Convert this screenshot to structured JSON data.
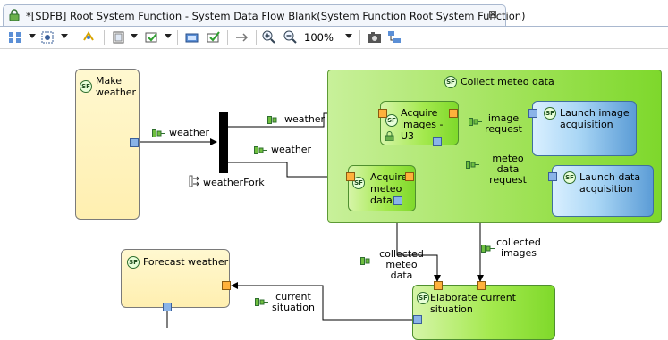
{
  "tab": {
    "title": "*[SDFB] Root System Function - System Data Flow Blank(System Function Root System Function)",
    "close_glyph": "⊠"
  },
  "toolbar": {
    "zoom_level": "100%",
    "icons": [
      "select-icon",
      "dropdown",
      "arrange-icon",
      "dropdown",
      "refresh-icon",
      "layer-icon",
      "dropdown",
      "filter-icon",
      "dropdown",
      "export-icon",
      "apply-icon",
      "hide-icon",
      "zoom-in-icon",
      "zoom-out-icon",
      "zoom-level",
      "dropdown",
      "camera-icon",
      "diagram-props-icon"
    ]
  },
  "diagram": {
    "functions": {
      "make_weather": "Make weather",
      "forecast_weather": "Forecast weather",
      "collect_meteo_data": "Collect meteo data",
      "acquire_images": "Acquire images - U3",
      "acquire_meteo_data": "Acquire meteo data",
      "launch_image_acquisition": "Launch image acquisition",
      "launch_data_acquisition": "Launch data acquisition",
      "elaborate_current_situation": "Elaborate current situation"
    },
    "fork": "weatherFork",
    "badge": "SF",
    "exchanges": {
      "weather_in": "weather",
      "weather_top": "weather",
      "weather_bottom": "weather",
      "image_request": "image request",
      "meteo_data_request": "meteo data request",
      "collected_meteo_data": "collected meteo data",
      "collected_images": "collected images",
      "current_situation": "current situation"
    }
  },
  "colors": {
    "yellow_function": "#ffefb0",
    "green_function": "#a4e94e",
    "blue_function": "#a9d6f5",
    "in_port": "#ffb13b",
    "out_port": "#8ab4e8"
  }
}
